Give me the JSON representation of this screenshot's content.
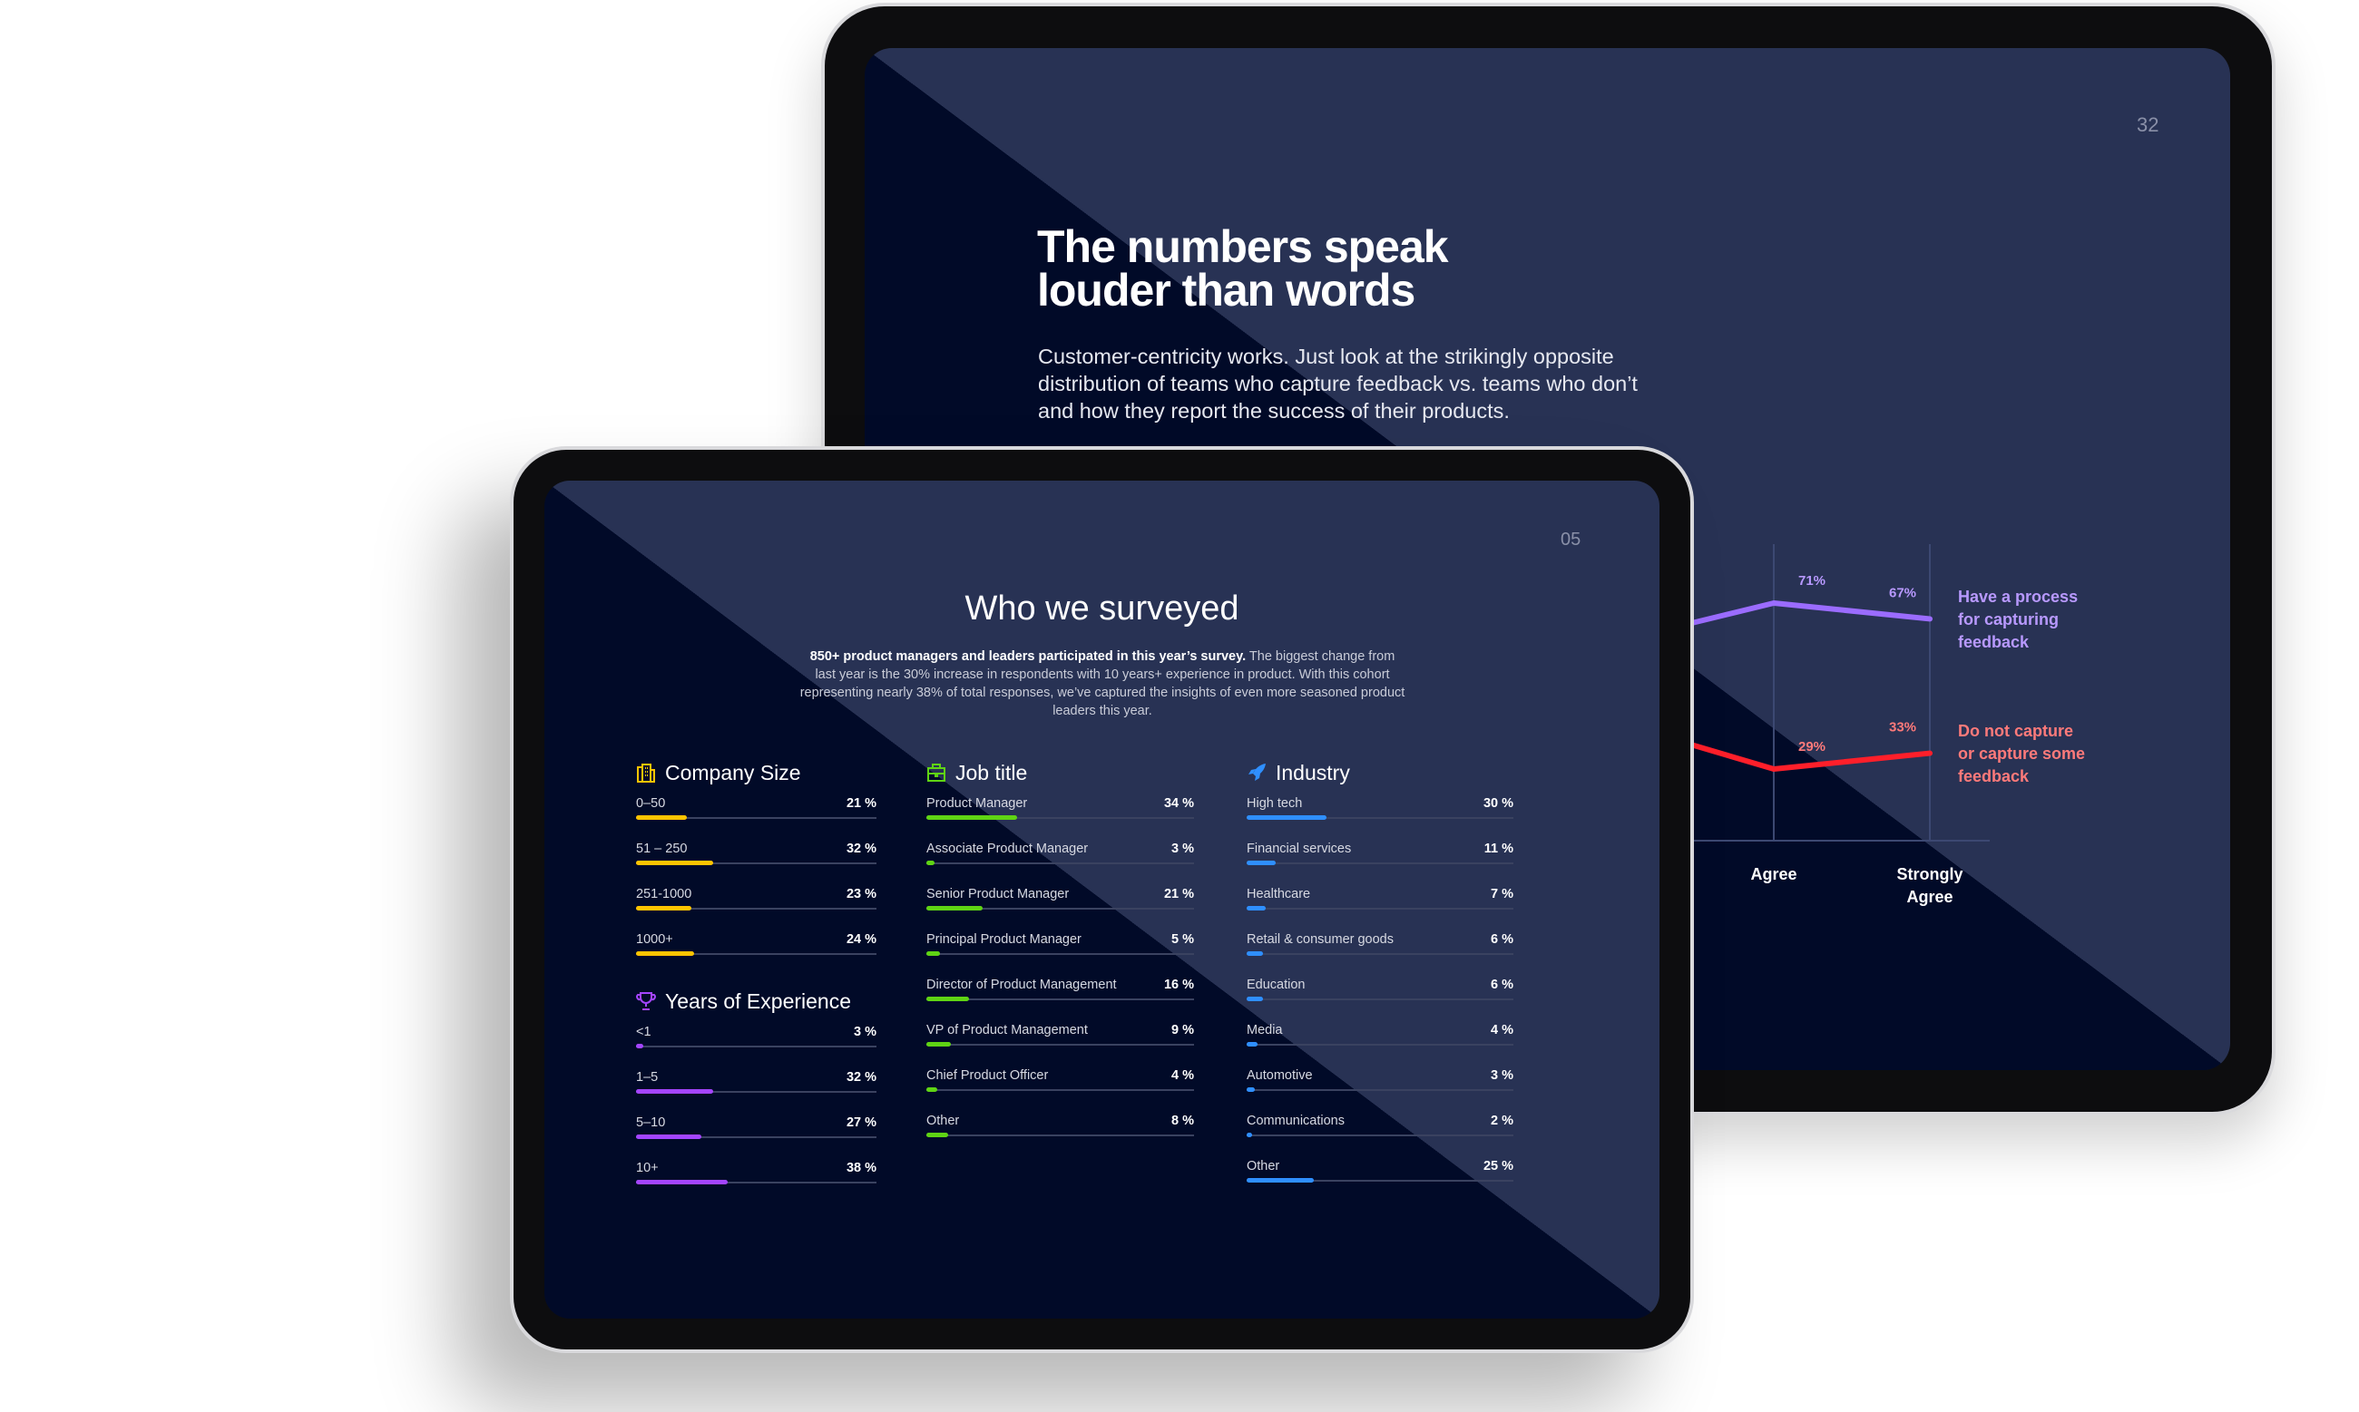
{
  "back_slide": {
    "page_number": "32",
    "title": "The numbers speak\nlouder than words",
    "paragraph": "Customer-centricity works. Just look at the strikingly opposite distribution of teams who capture feedback vs. teams who don’t and how they report the success of their products."
  },
  "chart_data": {
    "type": "line",
    "categories": [
      "Agree",
      "Strongly Agree"
    ],
    "series": [
      {
        "name": "Have a process for capturing feedback",
        "values": [
          71,
          67
        ],
        "labels": [
          "71%",
          "67%"
        ],
        "color": "#9b6cff"
      },
      {
        "name": "Do not capture or capture some feedback",
        "values": [
          29,
          33
        ],
        "labels": [
          "29%",
          "33%"
        ],
        "color": "#ff1f2a"
      }
    ],
    "legend_lines": [
      [
        "Have a process",
        "for capturing",
        "feedback"
      ],
      [
        "Do not capture",
        "or capture some",
        "feedback"
      ]
    ],
    "category_lines": [
      [
        "Agree"
      ],
      [
        "Strongly",
        "Agree"
      ]
    ],
    "legend_placement": "right",
    "grid": "vertical lines at categories",
    "legend_colors": [
      "#b899ff",
      "#ff7a7a"
    ]
  },
  "front_slide": {
    "page_number": "05",
    "title": "Who we surveyed",
    "paragraph_bold": "850+ product managers and leaders participated in this year’s survey.",
    "paragraph_rest": " The biggest change from last year is the 30% increase in respondents with 10 years+ experience in product. With this cohort representing nearly 38% of total responses, we’ve captured the insights of even more seasoned product leaders this year.",
    "sections": [
      {
        "key": "company",
        "title": "Company Size",
        "icon": "building-icon",
        "color": "#ffc400",
        "rows": [
          {
            "label": "0–50",
            "value": 21,
            "text": "21 %"
          },
          {
            "label": "51 – 250",
            "value": 32,
            "text": "32 %"
          },
          {
            "label": "251-1000",
            "value": 23,
            "text": "23 %"
          },
          {
            "label": "1000+",
            "value": 24,
            "text": "24 %"
          }
        ]
      },
      {
        "key": "years",
        "title": "Years of Experience",
        "icon": "trophy-icon",
        "color": "#a445ff",
        "rows": [
          {
            "label": "<1",
            "value": 3,
            "text": "3 %"
          },
          {
            "label": "1–5",
            "value": 32,
            "text": "32 %"
          },
          {
            "label": "5–10",
            "value": 27,
            "text": "27 %"
          },
          {
            "label": "10+",
            "value": 38,
            "text": "38 %"
          }
        ]
      },
      {
        "key": "job",
        "title": "Job title",
        "icon": "briefcase-icon",
        "color": "#5fd414",
        "rows": [
          {
            "label": "Product Manager",
            "value": 34,
            "text": "34 %"
          },
          {
            "label": "Associate Product Manager",
            "value": 3,
            "text": "3 %"
          },
          {
            "label": "Senior Product Manager",
            "value": 21,
            "text": "21 %"
          },
          {
            "label": "Principal Product Manager",
            "value": 5,
            "text": "5 %"
          },
          {
            "label": "Director of Product Management",
            "value": 16,
            "text": "16 %"
          },
          {
            "label": "VP of Product Management",
            "value": 9,
            "text": "9 %"
          },
          {
            "label": "Chief Product Officer",
            "value": 4,
            "text": "4 %"
          },
          {
            "label": "Other",
            "value": 8,
            "text": "8 %"
          }
        ]
      },
      {
        "key": "industry",
        "title": "Industry",
        "icon": "rocket-icon",
        "color": "#2f8fff",
        "rows": [
          {
            "label": "High tech",
            "value": 30,
            "text": "30 %"
          },
          {
            "label": "Financial services",
            "value": 11,
            "text": "11 %"
          },
          {
            "label": "Healthcare",
            "value": 7,
            "text": "7 %"
          },
          {
            "label": "Retail & consumer goods",
            "value": 6,
            "text": "6 %"
          },
          {
            "label": "Education",
            "value": 6,
            "text": "6 %"
          },
          {
            "label": "Media",
            "value": 4,
            "text": "4 %"
          },
          {
            "label": "Automotive",
            "value": 3,
            "text": "3 %"
          },
          {
            "label": "Communications",
            "value": 2,
            "text": "2 %"
          },
          {
            "label": "Other",
            "value": 25,
            "text": "25 %"
          }
        ]
      }
    ]
  }
}
